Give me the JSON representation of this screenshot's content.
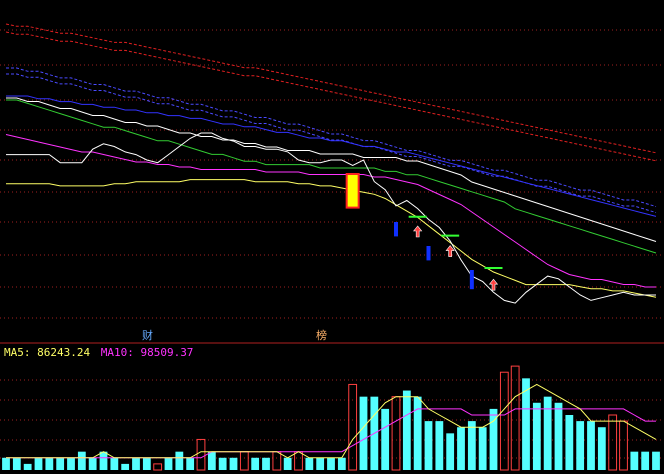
{
  "colors": {
    "background": "#000000",
    "grid": "#a02020",
    "divider": "#b02020",
    "price_line": "#ffffff",
    "ma_short": "#ffff66",
    "ma_mid": "#ff33ff",
    "ma_green": "#33cc33",
    "ma_blue": "#3333ff",
    "band_red": "#e02020",
    "band_blue": "#4a4aff",
    "candle_up_body": "#ffff00",
    "candle_up_border": "#ff2020",
    "candle_down": "#1030ff",
    "signal_bar": "#33ff33",
    "arrow": "#ff4040",
    "vol_up": "#ff4040",
    "vol_down": "#55ffff",
    "vol_ma5": "#ffff66",
    "vol_ma10": "#ff33ff",
    "badge_cai": "#66aaff",
    "badge_bang": "#ffb36b"
  },
  "badges": {
    "cai": "财",
    "bang": "榜"
  },
  "legend": {
    "ma5": "MA5: 86243.24",
    "ma10": "MA10: 98509.37"
  },
  "chart_data": {
    "type": "line",
    "x_count": 61,
    "price_panel": {
      "price_line": [
        18,
        18,
        18,
        18,
        18,
        21,
        21,
        21,
        16,
        14,
        15,
        17,
        18,
        20,
        21,
        18,
        15,
        12,
        10,
        10,
        12,
        13,
        15,
        15,
        16,
        16,
        17,
        20,
        21,
        21,
        20,
        20,
        22,
        20,
        28,
        31,
        37,
        35,
        38,
        42,
        45,
        50,
        57,
        63,
        65,
        69,
        72,
        73,
        69,
        66,
        63,
        64,
        67,
        70,
        72,
        71,
        70,
        69,
        70,
        70,
        70
      ],
      "ma_short": [
        18,
        18,
        18,
        18,
        18,
        19,
        19,
        19,
        19,
        19,
        18,
        18,
        17,
        17,
        17,
        17,
        17,
        16,
        16,
        16,
        16,
        16,
        16,
        17,
        17,
        17,
        17,
        18,
        18,
        19,
        19,
        20,
        21,
        22,
        23,
        25,
        28,
        31,
        34,
        38,
        42,
        46,
        50,
        54,
        57,
        60,
        62,
        64,
        66,
        66,
        66,
        66,
        66,
        67,
        68,
        68,
        69,
        69,
        70,
        71,
        72
      ],
      "ma_mid": [
        5,
        6,
        7,
        8,
        9,
        10,
        11,
        12,
        12,
        13,
        14,
        15,
        16,
        16,
        17,
        17,
        18,
        18,
        19,
        19,
        19,
        19,
        19,
        19,
        20,
        20,
        20,
        20,
        21,
        21,
        21,
        21,
        21,
        21,
        22,
        22,
        23,
        24,
        25,
        27,
        29,
        31,
        33,
        36,
        39,
        42,
        45,
        48,
        51,
        54,
        57,
        59,
        61,
        62,
        63,
        63,
        64,
        65,
        65,
        66,
        66
      ],
      "ma_green": [
        0,
        0,
        1,
        2,
        3,
        4,
        5,
        6,
        7,
        8,
        8,
        9,
        10,
        11,
        12,
        12,
        13,
        14,
        15,
        16,
        16,
        17,
        18,
        18,
        19,
        19,
        19,
        19,
        19,
        20,
        20,
        20,
        20,
        20,
        20,
        21,
        21,
        22,
        22,
        23,
        24,
        25,
        26,
        27,
        28,
        29,
        30,
        32,
        33,
        34,
        35,
        36,
        37,
        38,
        39,
        40,
        41,
        42,
        43,
        44,
        45
      ],
      "ma_white": [
        0,
        0,
        1,
        1,
        2,
        3,
        3,
        4,
        5,
        5,
        6,
        7,
        7,
        8,
        8,
        9,
        10,
        10,
        11,
        11,
        12,
        12,
        13,
        13,
        14,
        14,
        15,
        15,
        15,
        16,
        16,
        16,
        16,
        17,
        17,
        17,
        17,
        18,
        18,
        19,
        20,
        21,
        22,
        24,
        25,
        26,
        27,
        28,
        29,
        30,
        31,
        32,
        33,
        34,
        35,
        36,
        37,
        38,
        39,
        40,
        41
      ],
      "ma_blue": [
        0,
        0,
        0,
        1,
        1,
        2,
        2,
        3,
        3,
        4,
        4,
        5,
        5,
        6,
        6,
        7,
        7,
        8,
        8,
        9,
        10,
        10,
        11,
        11,
        12,
        13,
        13,
        14,
        15,
        15,
        16,
        16,
        17,
        18,
        18,
        19,
        20,
        20,
        21,
        22,
        23,
        24,
        25,
        26,
        27,
        28,
        29,
        30,
        31,
        32,
        33,
        34,
        35,
        36,
        37,
        38,
        39,
        40,
        41,
        42,
        43
      ],
      "band_red_upper": [
        0,
        1,
        1,
        2,
        3,
        4,
        4,
        5,
        6,
        7,
        8,
        8,
        9,
        10,
        11,
        12,
        13,
        14,
        15,
        16,
        17,
        18,
        19,
        19,
        20,
        21,
        22,
        23,
        24,
        25,
        26,
        27,
        28,
        29,
        30,
        31,
        32,
        33,
        34,
        35,
        36,
        37,
        38,
        39,
        40,
        41,
        42,
        43,
        44,
        45,
        46,
        47,
        48,
        49,
        50,
        51,
        52,
        53,
        54,
        55,
        56
      ],
      "band_red_lower": [
        0,
        1,
        1,
        2,
        3,
        4,
        4,
        5,
        6,
        7,
        8,
        8,
        9,
        10,
        11,
        12,
        13,
        14,
        15,
        16,
        17,
        18,
        19,
        19,
        20,
        21,
        22,
        23,
        24,
        25,
        26,
        27,
        28,
        29,
        30,
        31,
        32,
        33,
        34,
        35,
        36,
        37,
        38,
        39,
        40,
        41,
        42,
        43,
        44,
        45,
        46,
        47,
        48,
        49,
        50,
        51,
        52,
        53,
        54,
        55,
        56
      ],
      "band_blue_upper": [
        0,
        0,
        1,
        1,
        2,
        3,
        3,
        4,
        5,
        5,
        6,
        7,
        7,
        8,
        9,
        9,
        10,
        11,
        11,
        12,
        13,
        13,
        14,
        15,
        15,
        16,
        17,
        17,
        18,
        19,
        20,
        20,
        21,
        22,
        22,
        23,
        24,
        25,
        25,
        26,
        27,
        28,
        28,
        29,
        30,
        31,
        31,
        32,
        33,
        34,
        34,
        35,
        36,
        37,
        37,
        38,
        39,
        40,
        40,
        41,
        42
      ],
      "band_blue_lower": [
        0,
        0,
        1,
        1,
        2,
        3,
        3,
        4,
        5,
        5,
        6,
        7,
        7,
        8,
        9,
        9,
        10,
        11,
        11,
        12,
        13,
        13,
        14,
        15,
        15,
        16,
        17,
        17,
        18,
        19,
        20,
        20,
        21,
        22,
        22,
        23,
        24,
        25,
        25,
        26,
        27,
        28,
        28,
        29,
        30,
        31,
        31,
        32,
        33,
        34,
        34,
        35,
        36,
        37,
        37,
        38,
        39,
        40,
        40,
        41,
        42
      ]
    },
    "candles": [
      {
        "i": 32,
        "open": 24,
        "close": 10,
        "dir": "up"
      },
      {
        "i": 36,
        "open": 30,
        "close": 36,
        "dir": "down"
      },
      {
        "i": 39,
        "open": 40,
        "close": 46,
        "dir": "down"
      },
      {
        "i": 43,
        "open": 50,
        "close": 58,
        "dir": "down"
      }
    ],
    "signals": [
      {
        "i": 38,
        "level": 41
      },
      {
        "i": 41,
        "level": 48
      },
      {
        "i": 45,
        "level": 60
      }
    ],
    "arrows": [
      {
        "i": 38,
        "level": 45
      },
      {
        "i": 41,
        "level": 52
      },
      {
        "i": 45,
        "level": 64
      }
    ],
    "volume": {
      "bars": [
        2,
        2,
        1,
        2,
        2,
        2,
        2,
        3,
        2,
        3,
        2,
        1,
        2,
        2,
        1,
        2,
        3,
        2,
        5,
        3,
        2,
        2,
        3,
        2,
        2,
        3,
        2,
        3,
        2,
        2,
        2,
        2,
        14,
        12,
        12,
        10,
        12,
        13,
        12,
        8,
        8,
        6,
        7,
        8,
        7,
        10,
        16,
        17,
        15,
        11,
        12,
        11,
        9,
        8,
        8,
        7,
        9,
        8,
        3,
        3,
        3
      ],
      "up": [
        0,
        0,
        0,
        0,
        0,
        0,
        0,
        0,
        0,
        0,
        0,
        0,
        0,
        0,
        1,
        0,
        0,
        0,
        1,
        0,
        0,
        0,
        1,
        0,
        0,
        1,
        0,
        1,
        0,
        0,
        0,
        0,
        1,
        0,
        0,
        0,
        1,
        0,
        0,
        0,
        0,
        0,
        0,
        0,
        0,
        0,
        1,
        1,
        0,
        0,
        0,
        0,
        0,
        0,
        0,
        0,
        1,
        1,
        0,
        0,
        0
      ],
      "ma5": [
        2,
        2,
        2,
        2,
        2,
        2,
        2,
        2,
        2,
        3,
        2,
        2,
        2,
        2,
        2,
        2,
        2,
        2,
        3,
        3,
        3,
        3,
        3,
        3,
        3,
        3,
        2,
        3,
        2,
        2,
        2,
        2,
        5,
        7,
        9,
        11,
        12,
        12,
        12,
        10,
        9,
        8,
        7,
        7,
        7,
        8,
        10,
        12,
        13,
        14,
        13,
        12,
        11,
        10,
        8,
        8,
        8,
        8,
        7,
        6,
        5
      ],
      "ma10": [
        2,
        2,
        2,
        2,
        2,
        2,
        2,
        2,
        2,
        2,
        2,
        2,
        2,
        2,
        2,
        2,
        2,
        2,
        2,
        3,
        3,
        3,
        3,
        3,
        3,
        3,
        3,
        3,
        3,
        3,
        3,
        3,
        4,
        5,
        6,
        7,
        8,
        9,
        10,
        10,
        10,
        10,
        10,
        9,
        9,
        9,
        9,
        10,
        10,
        10,
        10,
        10,
        10,
        10,
        10,
        10,
        10,
        10,
        9,
        8,
        8
      ]
    }
  }
}
